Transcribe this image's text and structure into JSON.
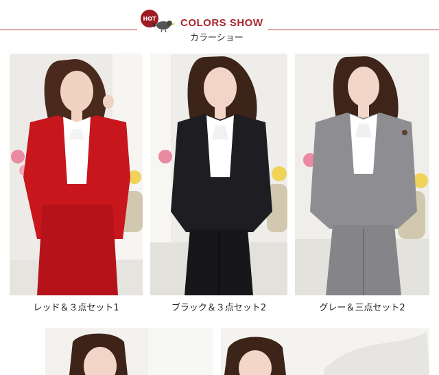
{
  "header": {
    "badge_text": "HOT",
    "title_en": "COLORS SHOW",
    "title_jp": "カラーショー"
  },
  "products": [
    {
      "caption": "レッド＆３点セット1",
      "suit_color": "#c8161d",
      "bottom": "skirt"
    },
    {
      "caption": "ブラック＆３点セット2",
      "suit_color": "#1e1e22",
      "bottom": "pants"
    },
    {
      "caption": "グレー＆三点セット2",
      "suit_color": "#8e8e92",
      "bottom": "pants"
    }
  ],
  "colors": {
    "accent": "#a9262c",
    "rule": "#b23a3a",
    "badge": "#9e1b23"
  }
}
